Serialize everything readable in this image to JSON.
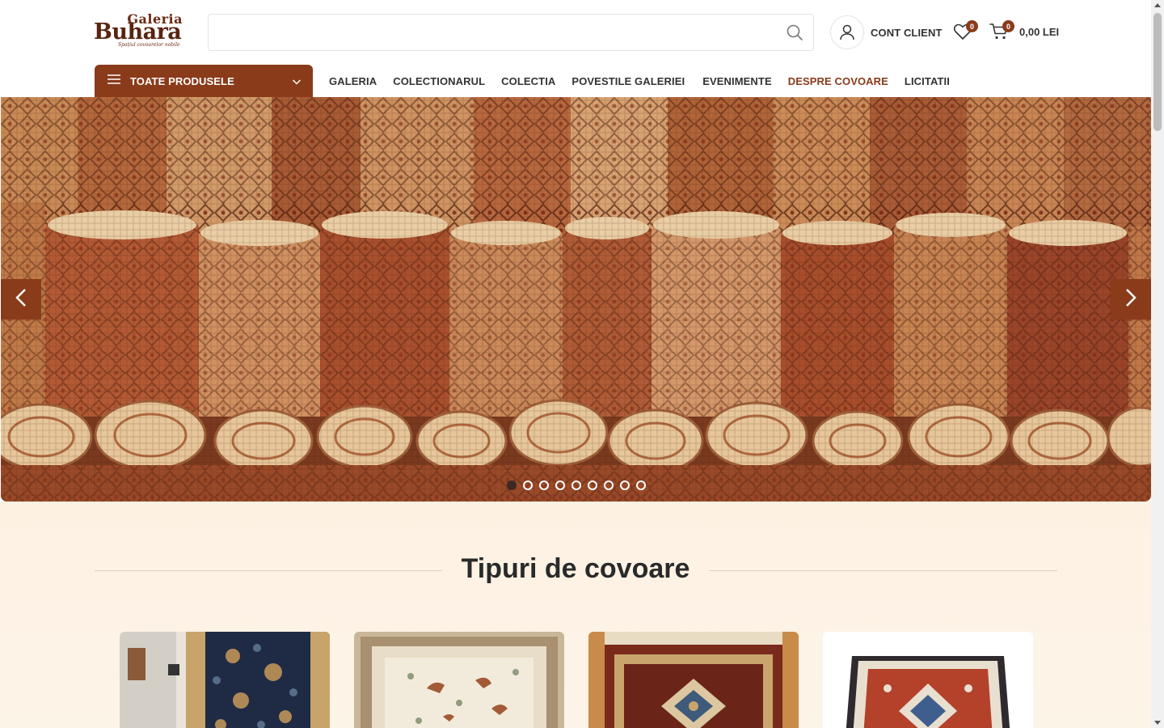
{
  "logo": {
    "line1": "Galeria",
    "line2": "Buhara",
    "tagline": "Spațiul covoarelor nobile"
  },
  "search": {
    "placeholder": "",
    "icon": "search-icon"
  },
  "account": {
    "label": "CONT CLIENT",
    "icon": "user-icon"
  },
  "wishlist": {
    "count": "0",
    "icon": "heart-icon"
  },
  "cart": {
    "count": "0",
    "total": "0,00 LEI",
    "icon": "cart-icon"
  },
  "nav": {
    "all_products": "TOATE PRODUSELE",
    "items": [
      {
        "label": "GALERIA"
      },
      {
        "label": "COLECTIONARUL"
      },
      {
        "label": "COLECTIA"
      },
      {
        "label": "POVESTILE GALERIEI"
      },
      {
        "label": "EVENIMENTE"
      },
      {
        "label": "DESPRE COVOARE"
      },
      {
        "label": "LICITATII"
      }
    ]
  },
  "slider": {
    "slide_count": 9,
    "active_index": 0
  },
  "section": {
    "title": "Tipuri de covoare"
  },
  "colors": {
    "brand": "#8a3b1a",
    "section_bg": "#fdf2e4"
  }
}
